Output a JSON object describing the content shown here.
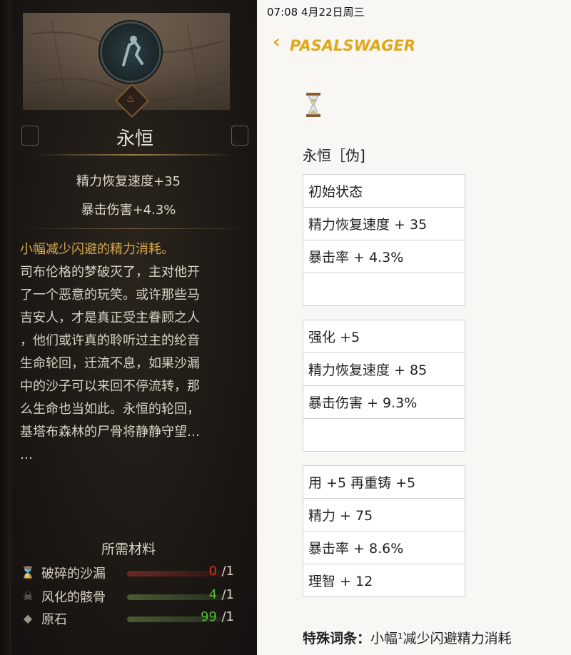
{
  "game_card": {
    "title": "永恒",
    "stats": [
      "精力恢复速度+35",
      "暴击伤害+4.3%"
    ],
    "highlight": "小幅减少闪避的精力消耗。",
    "lore": "司布伦格的梦破灭了，主对他开\n了一个恶意的玩笑。或许那些马\n吉安人，才是真正受主眷顾之人\n，他们或许真的聆听过主的纶音\n生命轮回，迁流不息，如果沙漏\n中的沙子可以来回不停流转，那\n么生命也当如此。永恒的轮回，\n基塔布森林的尸骨将静静守望…\n…",
    "materials_title": "所需材料",
    "materials": [
      {
        "icon": "broken-hourglass-icon",
        "name": "破碎的沙漏",
        "have": "0",
        "need": "/1",
        "have_color": "#d23a2a",
        "bar_color": "#5a2320"
      },
      {
        "icon": "skull-bones-icon",
        "name": "风化的骸骨",
        "have": "4",
        "need": "/1",
        "have_color": "#4fbf3a",
        "bar_color": "#3c4a2a"
      },
      {
        "icon": "ore-stone-icon",
        "name": "原石",
        "have": "99",
        "need": "/1",
        "have_color": "#4fbf3a",
        "bar_color": "#3c4a2a"
      }
    ]
  },
  "notes_app": {
    "status_time": "07:08   4月22日周三",
    "back_label": "PASALSWAGER",
    "icon": "hourglass-icon",
    "note_title": "永恒［伪]",
    "tables": [
      {
        "rows": [
          "初始状态",
          "精力恢复速度 + 35",
          "暴击率 + 4.3%",
          ""
        ]
      },
      {
        "rows": [
          "强化 +5",
          "精力恢复速度 + 85",
          "暴击伤害 + 9.3%",
          ""
        ]
      },
      {
        "rows": [
          "用 +5 再重铸 +5",
          "精力 + 75",
          "暴击率 + 8.6%",
          "理智 + 12"
        ]
      }
    ],
    "footer_label": "特殊词条：",
    "footer_text": "小幅¹减少闪避精力消耗"
  }
}
